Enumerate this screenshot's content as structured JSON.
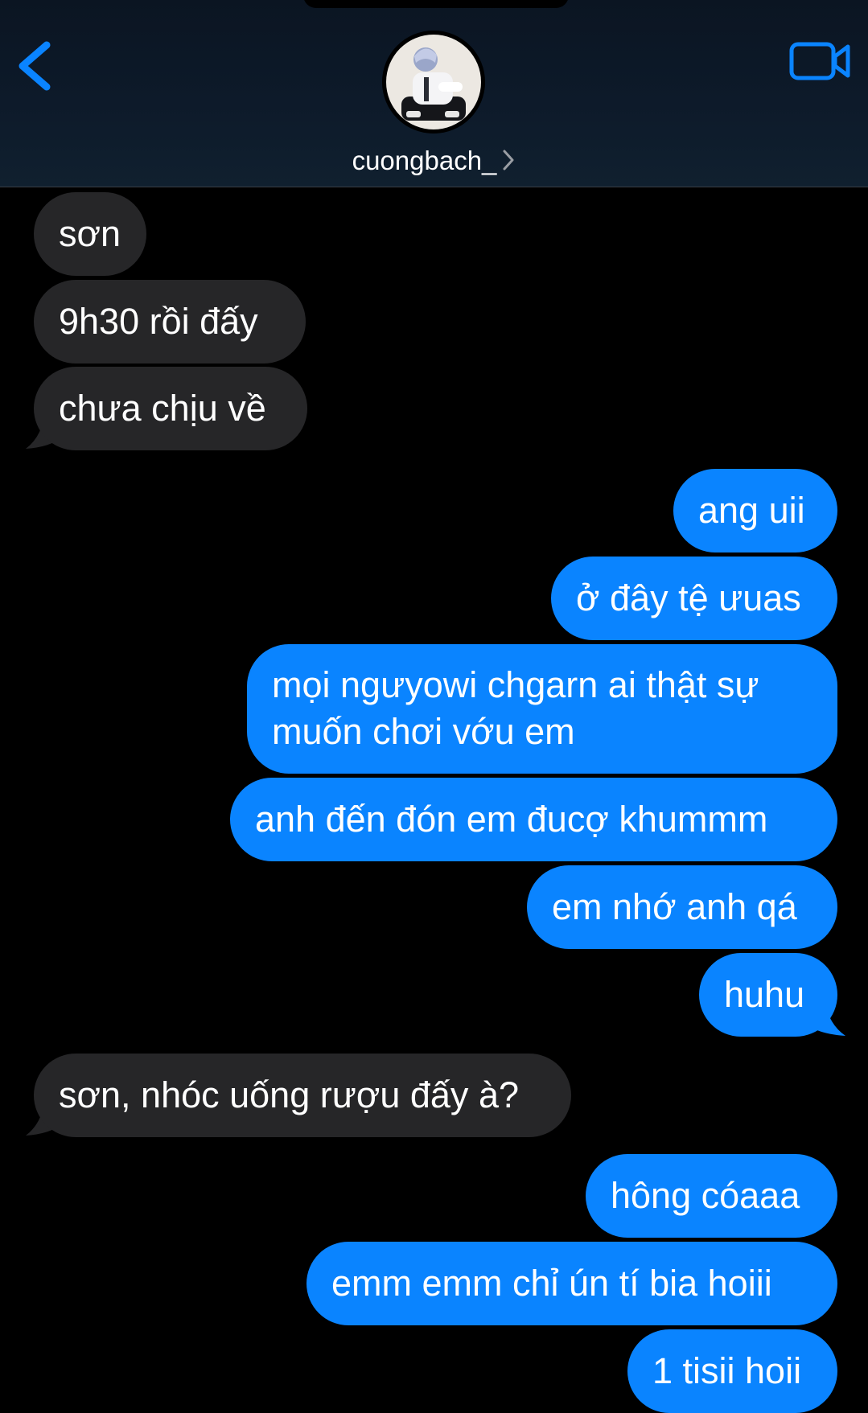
{
  "header": {
    "username": "cuongbach_",
    "back_icon": "chevron-left-icon",
    "video_icon": "video-camera-icon",
    "accent_color": "#0a84ff"
  },
  "messages": [
    {
      "from": "them",
      "text": "sơn"
    },
    {
      "from": "them",
      "text": "9h30 rồi đấy"
    },
    {
      "from": "them",
      "text": "chưa chịu về"
    },
    {
      "from": "me",
      "text": "ang uii"
    },
    {
      "from": "me",
      "text": "ở đây tệ ưuas"
    },
    {
      "from": "me",
      "text": "mọi ngưyowi chgarn ai thật sự muốn chơi vớu em"
    },
    {
      "from": "me",
      "text": "anh đến đón em đucợ khummm"
    },
    {
      "from": "me",
      "text": "em nhớ anh qá"
    },
    {
      "from": "me",
      "text": "huhu"
    },
    {
      "from": "them",
      "text": "sơn, nhóc uống rượu đấy à?"
    },
    {
      "from": "me",
      "text": "hông cóaaa"
    },
    {
      "from": "me",
      "text": "emm emm chỉ ún tí bia hoiii"
    },
    {
      "from": "me",
      "text": "1 tisii hoii"
    }
  ],
  "colors": {
    "received_bubble": "#262628",
    "sent_bubble": "#0a84ff",
    "background": "#000000"
  }
}
